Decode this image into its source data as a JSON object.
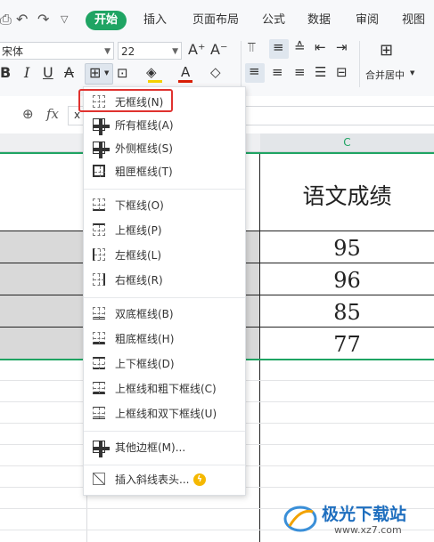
{
  "ribbon": {
    "tabs": [
      {
        "label": "开始",
        "active": true
      },
      {
        "label": "插入"
      },
      {
        "label": "页面布局"
      },
      {
        "label": "公式"
      },
      {
        "label": "数据"
      },
      {
        "label": "审阅"
      },
      {
        "label": "视图"
      }
    ],
    "font_name": "宋体",
    "font_size": "22",
    "merge_label": "合并居中",
    "accent_color": "#1fa463"
  },
  "formula_bar": {
    "fx_label": "fx",
    "cell_prefix": "x"
  },
  "sheet": {
    "column_c": "C",
    "header_text": "语文成绩",
    "scores": [
      "95",
      "96",
      "85",
      "77"
    ]
  },
  "border_menu": {
    "items": [
      {
        "label": "无框线(N)",
        "icon": "no-border-icon"
      },
      {
        "label": "所有框线(A)",
        "icon": "all-borders-icon"
      },
      {
        "label": "外侧框线(S)",
        "icon": "outside-borders-icon"
      },
      {
        "label": "粗匣框线(T)",
        "icon": "thick-box-border-icon"
      },
      {
        "label": "下框线(O)",
        "icon": "bottom-border-icon"
      },
      {
        "label": "上框线(P)",
        "icon": "top-border-icon"
      },
      {
        "label": "左框线(L)",
        "icon": "left-border-icon"
      },
      {
        "label": "右框线(R)",
        "icon": "right-border-icon"
      },
      {
        "label": "双底框线(B)",
        "icon": "double-bottom-border-icon"
      },
      {
        "label": "粗底框线(H)",
        "icon": "thick-bottom-border-icon"
      },
      {
        "label": "上下框线(D)",
        "icon": "top-bottom-border-icon"
      },
      {
        "label": "上框线和粗下框线(C)",
        "icon": "top-thick-bottom-border-icon"
      },
      {
        "label": "上框线和双下框线(U)",
        "icon": "top-double-bottom-border-icon"
      },
      {
        "label": "其他边框(M)...",
        "icon": "more-borders-icon"
      },
      {
        "label": "插入斜线表头...",
        "icon": "diagonal-header-icon"
      }
    ],
    "highlight_color": "#e0322f"
  },
  "watermark": {
    "text": "极光下载站",
    "url": "www.xz7.com"
  }
}
